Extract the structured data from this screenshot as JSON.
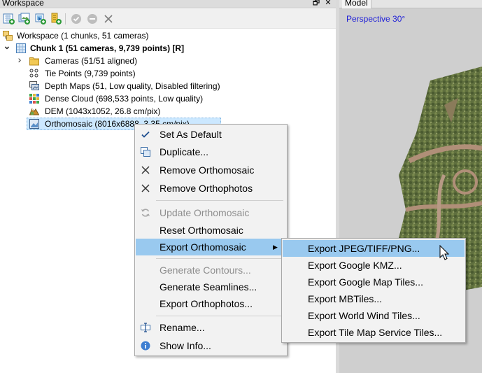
{
  "workspace": {
    "title": "Workspace",
    "float_glyph": "🗗",
    "close_glyph": "✕",
    "toolbar": [
      "add-chunk-icon",
      "add-photos-icon",
      "add-folder-icon",
      "add-markers-icon",
      "enable-icon",
      "disable-icon",
      "remove-icon"
    ]
  },
  "tree": {
    "root": "Workspace (1 chunks, 51 cameras)",
    "chunk": "Chunk 1 (51 cameras, 9,739 points) [R]",
    "cameras": "Cameras (51/51 aligned)",
    "tie_points": "Tie Points (9,739 points)",
    "depth_maps": "Depth Maps (51, Low quality, Disabled filtering)",
    "dense_cloud": "Dense Cloud (698,533 points, Low quality)",
    "dem": "DEM (1043x1052, 26.8 cm/pix)",
    "orthomosaic": "Orthomosaic (8016x6888, 3.35 cm/pix)",
    "chunk_expander": "⌄",
    "cameras_expander": "›"
  },
  "viewport": {
    "tab": "Model",
    "overlay": "Perspective 30°"
  },
  "context_menu": {
    "items": [
      {
        "label": "Set As Default",
        "icon": "check-icon"
      },
      {
        "label": "Duplicate...",
        "icon": "duplicate-icon"
      },
      {
        "label": "Remove Orthomosaic",
        "icon": "remove-icon"
      },
      {
        "label": "Remove Orthophotos",
        "icon": "remove-icon"
      },
      {
        "label": "Update Orthomosaic",
        "icon": "refresh-icon"
      },
      {
        "label": "Reset Orthomosaic",
        "icon": ""
      },
      {
        "label": "Export Orthomosaic",
        "icon": ""
      },
      {
        "label": "Generate Contours...",
        "icon": ""
      },
      {
        "label": "Generate Seamlines...",
        "icon": ""
      },
      {
        "label": "Export Orthophotos...",
        "icon": ""
      },
      {
        "label": "Rename...",
        "icon": "rename-icon"
      },
      {
        "label": "Show Info...",
        "icon": "info-icon"
      }
    ],
    "submenu_arrow": "▶"
  },
  "export_submenu": {
    "items": [
      "Export JPEG/TIFF/PNG...",
      "Export Google KMZ...",
      "Export Google Map Tiles...",
      "Export MBTiles...",
      "Export World Wind Tiles...",
      "Export Tile Map Service Tiles..."
    ]
  },
  "colors": {
    "selection": "#cce8ff",
    "menu_highlight": "#99c9ef",
    "overlay_text": "#1f1fd8",
    "disabled_text": "#8e8e8e"
  }
}
